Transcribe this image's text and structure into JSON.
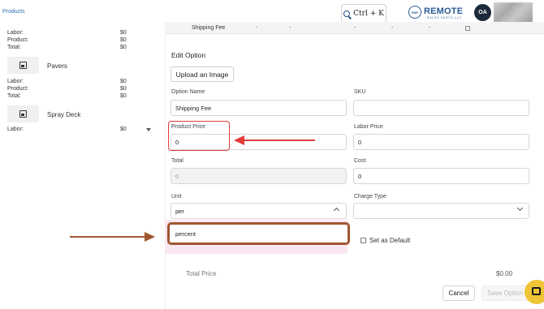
{
  "header": {
    "breadcrumb": "Products",
    "shortcut_label": "Ctrl + K",
    "logo_badge": "RSP",
    "logo_text": "REMOTE",
    "logo_sub": "SALES PARTS LLC",
    "avatar_initials": "OA"
  },
  "left_panel": {
    "block1": [
      {
        "label": "Labor:",
        "value": "$0"
      },
      {
        "label": "Product:",
        "value": "$0"
      },
      {
        "label": "Total:",
        "value": "$0"
      }
    ],
    "pavers": {
      "name": "Pavers",
      "rows": [
        {
          "label": "Labor:",
          "value": "$0"
        },
        {
          "label": "Product:",
          "value": "$0"
        },
        {
          "label": "Total:",
          "value": "$0"
        }
      ]
    },
    "spray_deck": {
      "name": "Spray Deck",
      "rows": [
        {
          "label": "Labor:",
          "value": "$0"
        }
      ]
    }
  },
  "table_strip": {
    "name": "Shipping Fee",
    "cells": [
      "-",
      "-",
      "-",
      "-",
      "-"
    ]
  },
  "form": {
    "title": "Edit Option",
    "upload_label": "Upload an Image",
    "option_name": {
      "label": "Option Name",
      "value": "Shipping Fee"
    },
    "sku": {
      "label": "SKU",
      "value": ""
    },
    "product_price": {
      "label": "Product Price",
      "value": "0"
    },
    "labor_price": {
      "label": "Labor Price",
      "value": "0"
    },
    "total": {
      "label": "Total",
      "value": "0"
    },
    "cost": {
      "label": "Cost",
      "value": "0"
    },
    "unit": {
      "label": "Unit",
      "value": "per",
      "options": [
        "percent"
      ]
    },
    "charge_type": {
      "label": "Charge Type",
      "value": ""
    },
    "set_default_label": "Set as Default",
    "total_price_label": "Total Price",
    "total_price_value": "$0.00",
    "cancel_label": "Cancel",
    "save_label": "Save Option"
  },
  "colors": {
    "accent": "#2a5b96",
    "highlight_red": "#e23b3b",
    "highlight_brown": "#a0562f",
    "chat": "#f0c437"
  }
}
